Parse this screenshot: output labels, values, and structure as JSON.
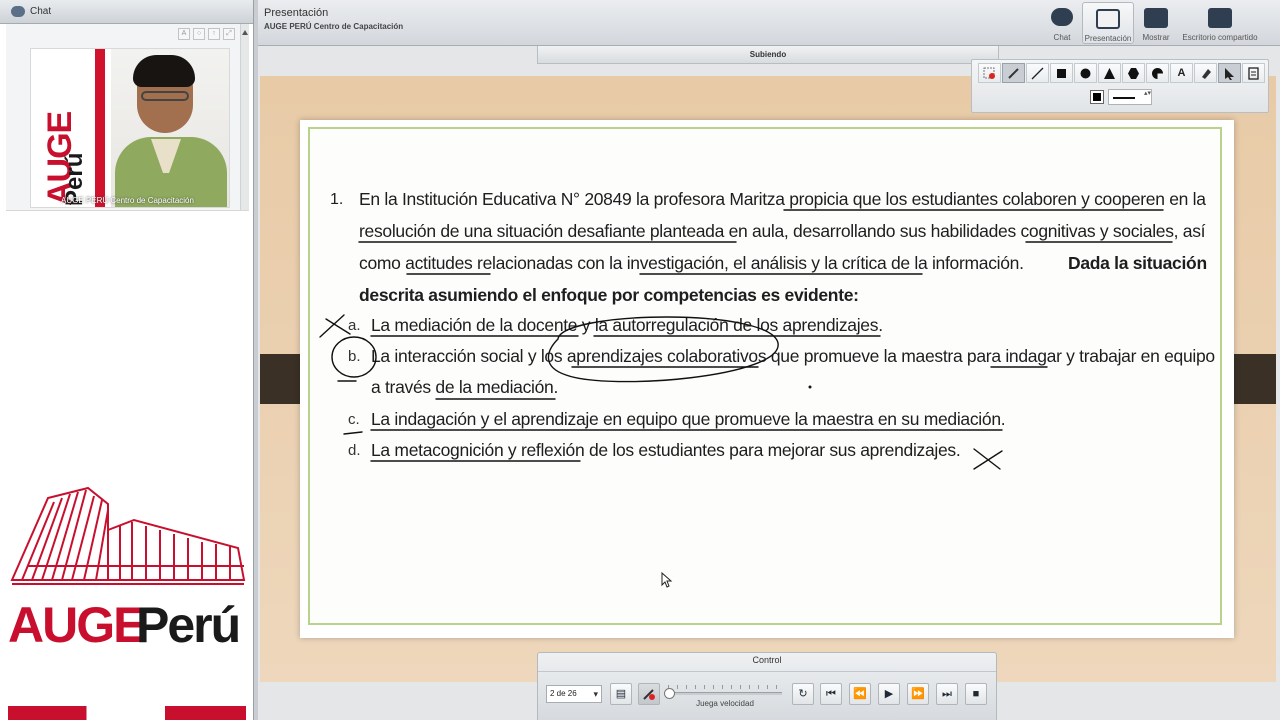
{
  "chat_panel": {
    "title": "Chat",
    "webcam_caption": "AUGE PERÚ Centro de Capacitación",
    "logo_auge": "AUGE",
    "logo_peru": "Perú"
  },
  "left_logo": {
    "auge": "AUGE",
    "peru": "Perú"
  },
  "header": {
    "title": "Presentación",
    "subtitle": "AUGE PERÚ Centro de Capacitación",
    "modes": [
      {
        "label": "Chat",
        "icon": "chat-bubble-icon"
      },
      {
        "label": "Presentación",
        "icon": "presentation-screen-icon",
        "active": true
      },
      {
        "label": "Mostrar",
        "icon": "projector-icon"
      },
      {
        "label": "Escritorio compartido",
        "icon": "monitor-icon"
      }
    ]
  },
  "upload_status": "Subiendo",
  "slide": {
    "number": "1.",
    "question_lines": [
      "En la Institución Educativa N° 20849 la profesora Maritza propicia que los estudiantes colaboren y cooperen en la",
      "resolución de una situación desafiante planteada en aula, desarrollando sus habilidades cognitivas y sociales, así",
      "como actitudes relacionadas con la investigación, el análisis y la crítica de la información.",
      "descrita asumiendo el enfoque por competencias es evidente:"
    ],
    "bold_lead": "Dada la situación",
    "options": [
      {
        "letter": "a.",
        "text": "La mediación de la docente y la autorregulación de los aprendizajes."
      },
      {
        "letter": "b.",
        "text": "La interacción social y los aprendizajes colaborativos que promueve la maestra para indagar y trabajar en equipo",
        "text2": "a través de la mediación."
      },
      {
        "letter": "c.",
        "text": "La indagación y el aprendizaje en equipo que promueve la maestra en su mediación."
      },
      {
        "letter": "d.",
        "text": "La metacognición y reflexión de los estudiantes para mejorar sus aprendizajes."
      }
    ]
  },
  "draw_toolbar": {
    "tools": [
      "delete-drawing-icon",
      "pen-icon",
      "line-icon",
      "rectangle-icon",
      "circle-icon",
      "triangle-icon",
      "hexagon-icon",
      "pie-icon",
      "text-icon",
      "eraser-icon",
      "pointer-icon",
      "clipboard-icon"
    ],
    "active_tool": "pen-icon",
    "color": "#000000"
  },
  "control": {
    "title": "Control",
    "page": "2 de 26",
    "speed_label": "Juega velocidad",
    "buttons": [
      "document-icon",
      "clear-annotations-icon",
      "refresh-icon",
      "first-slide-icon",
      "rewind-icon",
      "play-icon",
      "fast-forward-icon",
      "last-slide-icon",
      "stop-icon"
    ]
  },
  "colors": {
    "brand_red": "#c8102e",
    "slide_border": "#b7d48a",
    "slide_bg": "#e8caa6"
  }
}
